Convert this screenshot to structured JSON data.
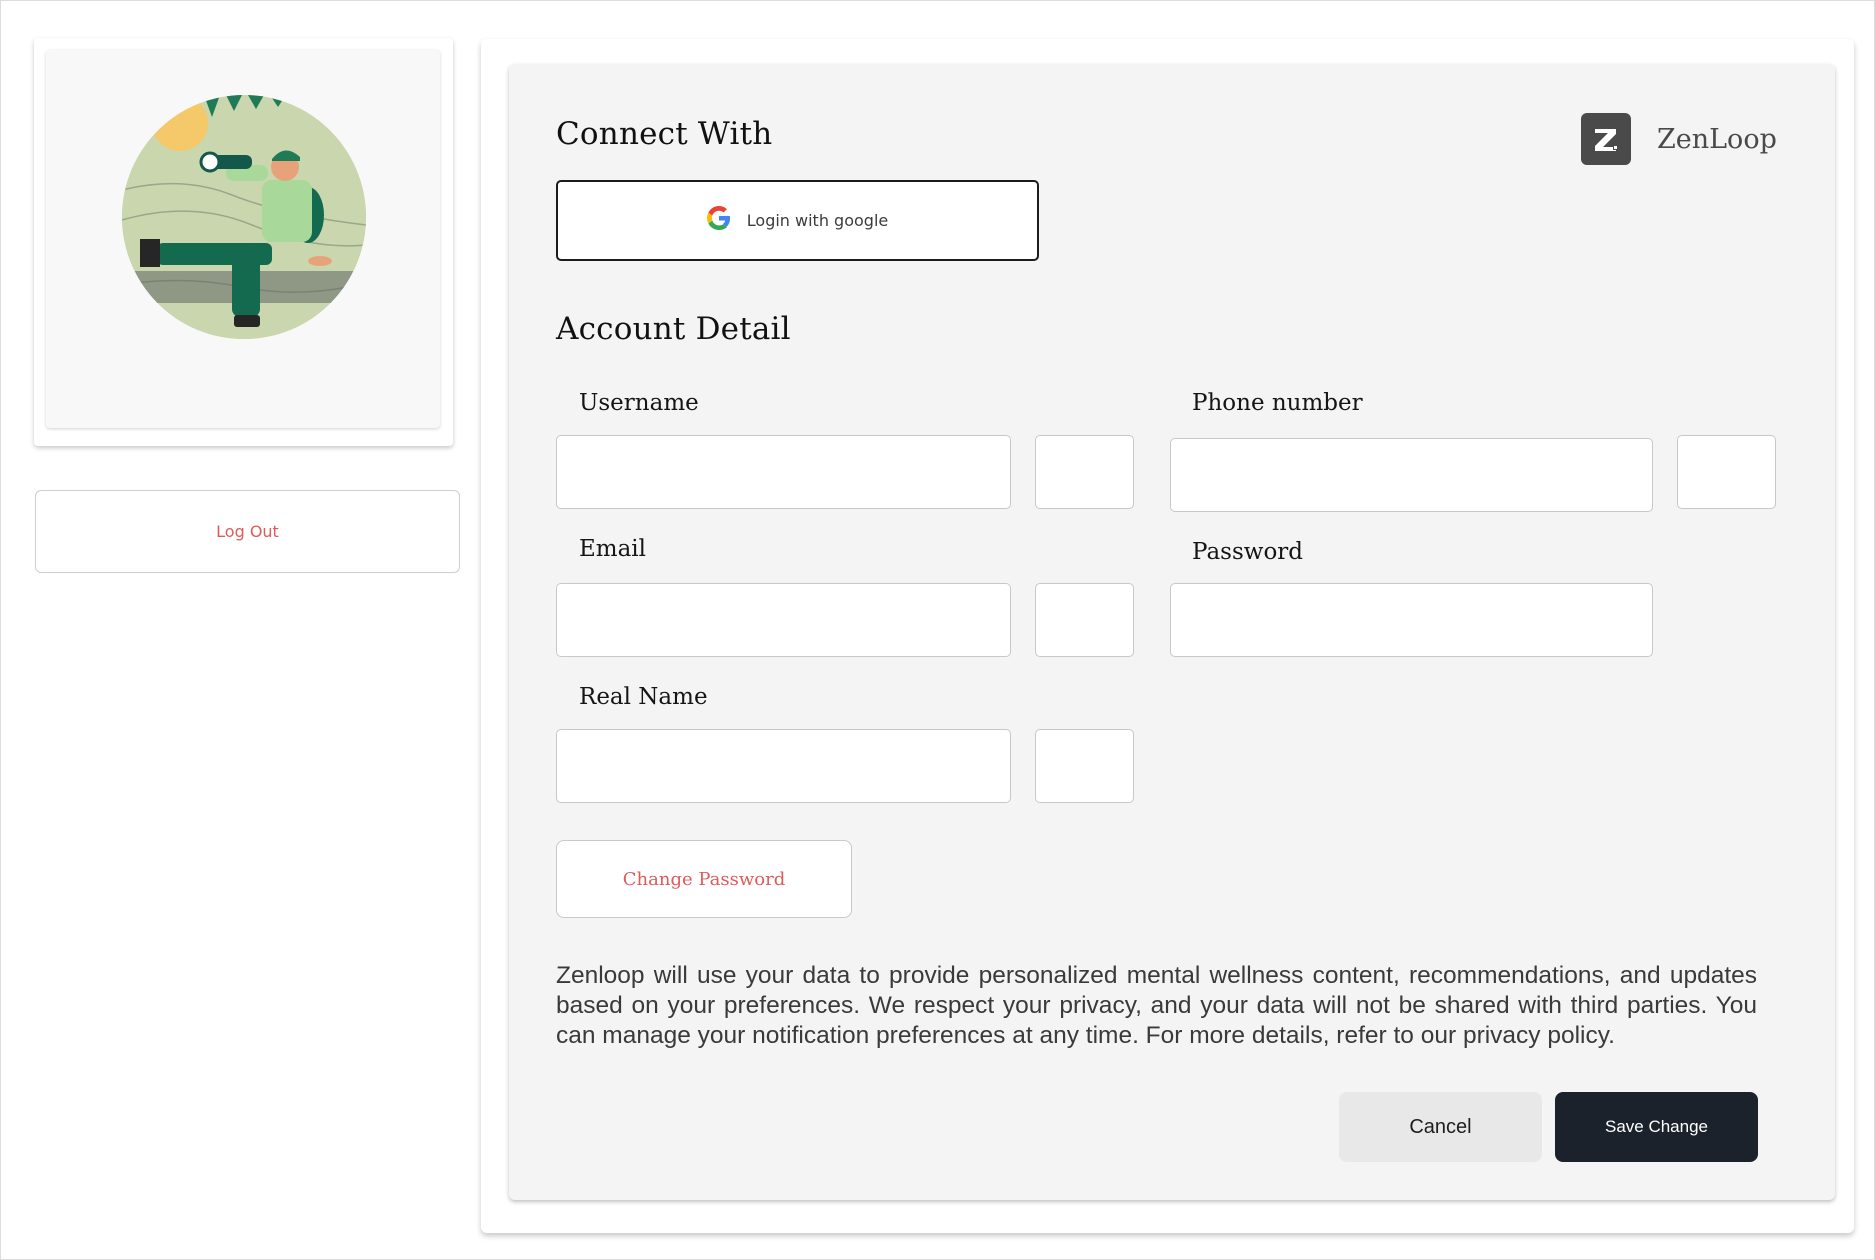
{
  "sidebar": {
    "logout_label": "Log Out"
  },
  "brand": {
    "name": "ZenLoop",
    "icon": "zenloop-logo-icon"
  },
  "connect": {
    "title": "Connect With",
    "google_label": "Login with google",
    "google_icon": "google-icon"
  },
  "account": {
    "title": "Account Detail",
    "fields": {
      "username": {
        "label": "Username",
        "value": ""
      },
      "phone": {
        "label": "Phone number",
        "value": ""
      },
      "email": {
        "label": "Email",
        "value": ""
      },
      "password": {
        "label": "Password",
        "value": ""
      },
      "real_name": {
        "label": "Real Name",
        "value": ""
      }
    },
    "change_password_label": "Change Password"
  },
  "privacy_text": "Zenloop will use your data to provide personalized mental wellness content, recommendations, and updates based on your preferences. We respect your privacy, and your data will not be shared with third parties. You can manage your notification preferences at any time. For more details, refer to our privacy policy.",
  "actions": {
    "cancel_label": "Cancel",
    "save_label": "Save Change"
  },
  "colors": {
    "accent_red": "#e05a5a",
    "primary_dark": "#1b222c",
    "panel_bg": "#f4f4f4"
  }
}
